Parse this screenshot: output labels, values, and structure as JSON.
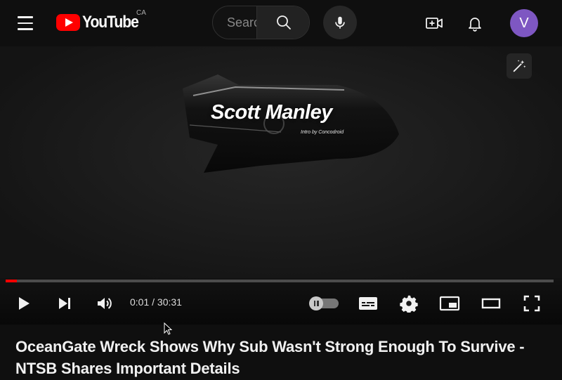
{
  "header": {
    "logo_text": "YouTube",
    "region": "CA",
    "search_placeholder": "Search",
    "avatar_letter": "V"
  },
  "video": {
    "intro_title": "Scott Manley",
    "intro_credit": "Intro by Concodroid",
    "current_time": "0:01",
    "duration": "30:31",
    "time_display": "0:01 / 30:31",
    "progress_played_fraction": 0.0006,
    "progress_loaded_fraction": 0.015,
    "autoplay": "off"
  },
  "page": {
    "title": "OceanGate Wreck Shows Why Sub Wasn't Strong Enough To Survive - NTSB Shares Important Details"
  },
  "colors": {
    "brand_red": "#ff0000",
    "avatar": "#7e57c2",
    "background": "#0f0f0f"
  }
}
